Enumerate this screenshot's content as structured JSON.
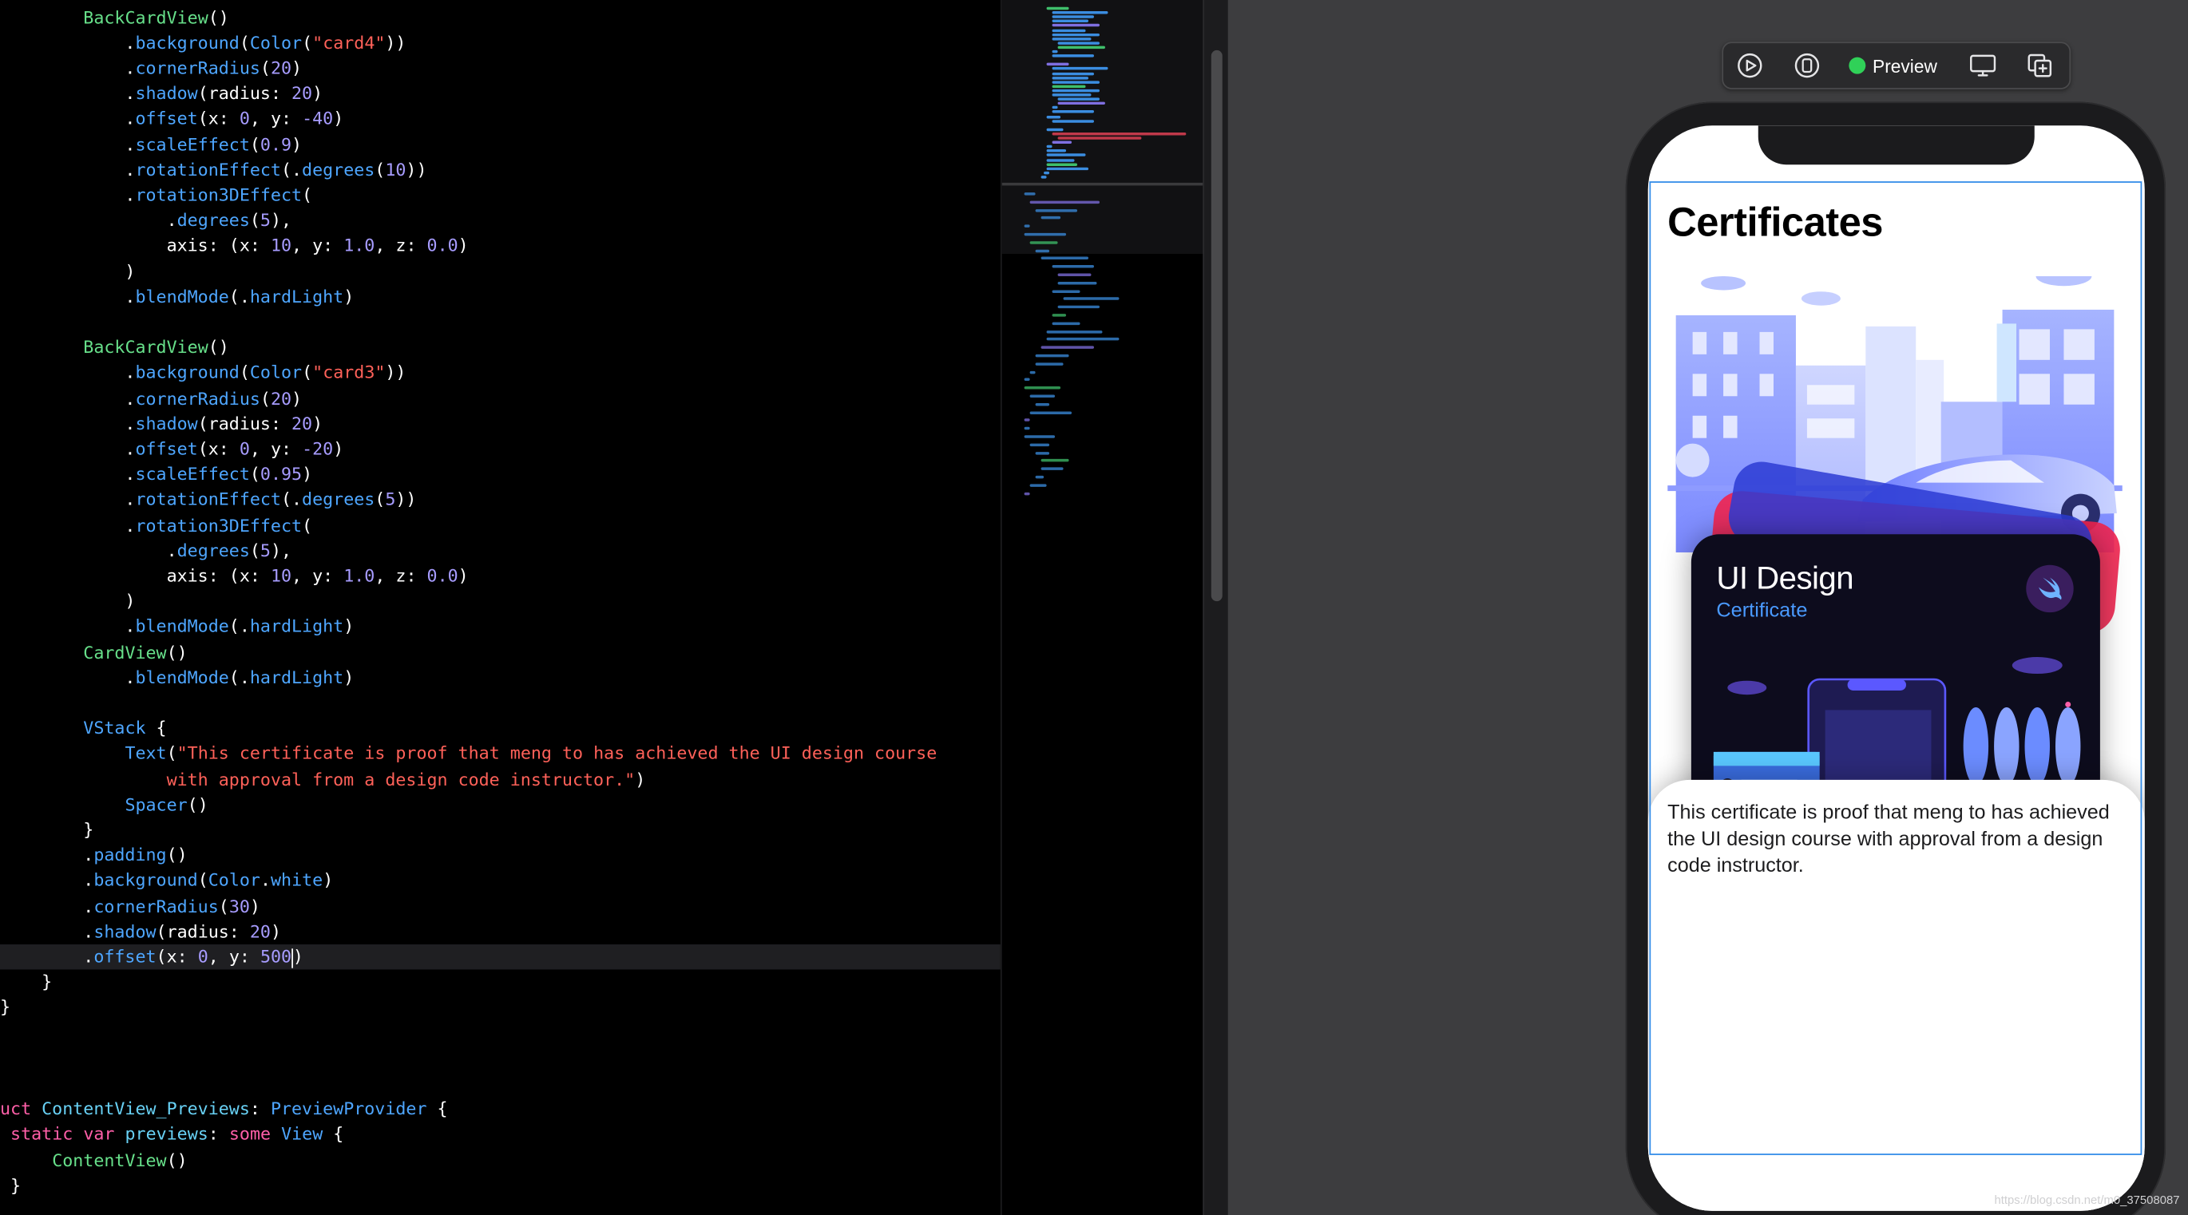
{
  "editor": {
    "lines": [
      [
        [
          "        ",
          ""
        ],
        [
          "BackCardView",
          "fn"
        ],
        [
          "()",
          ""
        ]
      ],
      [
        [
          "            .",
          ""
        ],
        [
          "background",
          "mod"
        ],
        [
          "(",
          ""
        ],
        [
          "Color",
          "type"
        ],
        [
          "(",
          ""
        ],
        [
          "\"card4\"",
          "str"
        ],
        [
          "))",
          ""
        ]
      ],
      [
        [
          "            .",
          ""
        ],
        [
          "cornerRadius",
          "mod"
        ],
        [
          "(",
          ""
        ],
        [
          "20",
          "num"
        ],
        [
          ")",
          ""
        ]
      ],
      [
        [
          "            .",
          ""
        ],
        [
          "shadow",
          "mod"
        ],
        [
          "(radius: ",
          ""
        ],
        [
          "20",
          "num"
        ],
        [
          ")",
          ""
        ]
      ],
      [
        [
          "            .",
          ""
        ],
        [
          "offset",
          "mod"
        ],
        [
          "(x: ",
          ""
        ],
        [
          "0",
          "num"
        ],
        [
          ", y: ",
          ""
        ],
        [
          "-40",
          "num"
        ],
        [
          ")",
          ""
        ]
      ],
      [
        [
          "            .",
          ""
        ],
        [
          "scaleEffect",
          "mod"
        ],
        [
          "(",
          ""
        ],
        [
          "0.9",
          "num"
        ],
        [
          ")",
          ""
        ]
      ],
      [
        [
          "            .",
          ""
        ],
        [
          "rotationEffect",
          "mod"
        ],
        [
          "(.",
          ""
        ],
        [
          "degrees",
          "mod"
        ],
        [
          "(",
          ""
        ],
        [
          "10",
          "num"
        ],
        [
          "))",
          ""
        ]
      ],
      [
        [
          "            .",
          ""
        ],
        [
          "rotation3DEffect",
          "mod"
        ],
        [
          "(",
          ""
        ]
      ],
      [
        [
          "                .",
          ""
        ],
        [
          "degrees",
          "mod"
        ],
        [
          "(",
          ""
        ],
        [
          "5",
          "num"
        ],
        [
          "),",
          ""
        ]
      ],
      [
        [
          "                axis: (x: ",
          ""
        ],
        [
          "10",
          "num"
        ],
        [
          ", y: ",
          ""
        ],
        [
          "1.0",
          "num"
        ],
        [
          ", z: ",
          ""
        ],
        [
          "0.0",
          "num"
        ],
        [
          ")",
          ""
        ]
      ],
      [
        [
          "            )",
          ""
        ]
      ],
      [
        [
          "            .",
          ""
        ],
        [
          "blendMode",
          "mod"
        ],
        [
          "(.",
          ""
        ],
        [
          "hardLight",
          "mod"
        ],
        [
          ")",
          ""
        ]
      ],
      [
        [
          "",
          ""
        ]
      ],
      [
        [
          "        ",
          ""
        ],
        [
          "BackCardView",
          "fn"
        ],
        [
          "()",
          ""
        ]
      ],
      [
        [
          "            .",
          ""
        ],
        [
          "background",
          "mod"
        ],
        [
          "(",
          ""
        ],
        [
          "Color",
          "type"
        ],
        [
          "(",
          ""
        ],
        [
          "\"card3\"",
          "str"
        ],
        [
          "))",
          ""
        ]
      ],
      [
        [
          "            .",
          ""
        ],
        [
          "cornerRadius",
          "mod"
        ],
        [
          "(",
          ""
        ],
        [
          "20",
          "num"
        ],
        [
          ")",
          ""
        ]
      ],
      [
        [
          "            .",
          ""
        ],
        [
          "shadow",
          "mod"
        ],
        [
          "(radius: ",
          ""
        ],
        [
          "20",
          "num"
        ],
        [
          ")",
          ""
        ]
      ],
      [
        [
          "            .",
          ""
        ],
        [
          "offset",
          "mod"
        ],
        [
          "(x: ",
          ""
        ],
        [
          "0",
          "num"
        ],
        [
          ", y: ",
          ""
        ],
        [
          "-20",
          "num"
        ],
        [
          ")",
          ""
        ]
      ],
      [
        [
          "            .",
          ""
        ],
        [
          "scaleEffect",
          "mod"
        ],
        [
          "(",
          ""
        ],
        [
          "0.95",
          "num"
        ],
        [
          ")",
          ""
        ]
      ],
      [
        [
          "            .",
          ""
        ],
        [
          "rotationEffect",
          "mod"
        ],
        [
          "(.",
          ""
        ],
        [
          "degrees",
          "mod"
        ],
        [
          "(",
          ""
        ],
        [
          "5",
          "num"
        ],
        [
          "))",
          ""
        ]
      ],
      [
        [
          "            .",
          ""
        ],
        [
          "rotation3DEffect",
          "mod"
        ],
        [
          "(",
          ""
        ]
      ],
      [
        [
          "                .",
          ""
        ],
        [
          "degrees",
          "mod"
        ],
        [
          "(",
          ""
        ],
        [
          "5",
          "num"
        ],
        [
          "),",
          ""
        ]
      ],
      [
        [
          "                axis: (x: ",
          ""
        ],
        [
          "10",
          "num"
        ],
        [
          ", y: ",
          ""
        ],
        [
          "1.0",
          "num"
        ],
        [
          ", z: ",
          ""
        ],
        [
          "0.0",
          "num"
        ],
        [
          ")",
          ""
        ]
      ],
      [
        [
          "            )",
          ""
        ]
      ],
      [
        [
          "            .",
          ""
        ],
        [
          "blendMode",
          "mod"
        ],
        [
          "(.",
          ""
        ],
        [
          "hardLight",
          "mod"
        ],
        [
          ")",
          ""
        ]
      ],
      [
        [
          "        ",
          ""
        ],
        [
          "CardView",
          "fn"
        ],
        [
          "()",
          ""
        ]
      ],
      [
        [
          "            .",
          ""
        ],
        [
          "blendMode",
          "mod"
        ],
        [
          "(.",
          ""
        ],
        [
          "hardLight",
          "mod"
        ],
        [
          ")",
          ""
        ]
      ],
      [
        [
          "",
          ""
        ]
      ],
      [
        [
          "        ",
          ""
        ],
        [
          "VStack",
          "type"
        ],
        [
          " {",
          ""
        ]
      ],
      [
        [
          "            ",
          ""
        ],
        [
          "Text",
          "type"
        ],
        [
          "(",
          ""
        ],
        [
          "\"This certificate is proof that meng to has achieved the UI design course",
          "str"
        ]
      ],
      [
        [
          "                ",
          ""
        ],
        [
          "with approval from a design code instructor.\"",
          "str"
        ],
        [
          ")",
          ""
        ]
      ],
      [
        [
          "            ",
          ""
        ],
        [
          "Spacer",
          "type"
        ],
        [
          "()",
          ""
        ]
      ],
      [
        [
          "        }",
          ""
        ]
      ],
      [
        [
          "        .",
          ""
        ],
        [
          "padding",
          "mod"
        ],
        [
          "()",
          ""
        ]
      ],
      [
        [
          "        .",
          ""
        ],
        [
          "background",
          "mod"
        ],
        [
          "(",
          ""
        ],
        [
          "Color",
          "type"
        ],
        [
          ".",
          ""
        ],
        [
          "white",
          "mod"
        ],
        [
          ")",
          ""
        ]
      ],
      [
        [
          "        .",
          ""
        ],
        [
          "cornerRadius",
          "mod"
        ],
        [
          "(",
          ""
        ],
        [
          "30",
          "num"
        ],
        [
          ")",
          ""
        ]
      ],
      [
        [
          "        .",
          ""
        ],
        [
          "shadow",
          "mod"
        ],
        [
          "(radius: ",
          ""
        ],
        [
          "20",
          "num"
        ],
        [
          ")",
          ""
        ]
      ],
      [
        [
          "        .",
          ""
        ],
        [
          "offset",
          "mod"
        ],
        [
          "(x: ",
          ""
        ],
        [
          "0",
          "num"
        ],
        [
          ", y: ",
          ""
        ],
        [
          "500",
          "num"
        ],
        [
          "",
          "cursor"
        ],
        [
          ")",
          ""
        ]
      ],
      [
        [
          "    }",
          ""
        ]
      ],
      [
        [
          "}",
          ""
        ]
      ],
      [
        [
          "",
          ""
        ]
      ],
      [
        [
          "",
          ""
        ]
      ],
      [
        [
          "",
          ""
        ]
      ],
      [
        [
          "uct ",
          "kw"
        ],
        [
          "ContentView_Previews",
          "cy"
        ],
        [
          ": ",
          ""
        ],
        [
          "PreviewProvider",
          "type"
        ],
        [
          " {",
          ""
        ]
      ],
      [
        [
          " ",
          ""
        ],
        [
          "static",
          "kw"
        ],
        [
          " ",
          ""
        ],
        [
          "var",
          "kw"
        ],
        [
          " ",
          ""
        ],
        [
          "previews",
          "cy"
        ],
        [
          ": ",
          ""
        ],
        [
          "some",
          "kw"
        ],
        [
          " ",
          ""
        ],
        [
          "View",
          "type"
        ],
        [
          " {",
          ""
        ]
      ],
      [
        [
          "     ",
          ""
        ],
        [
          "ContentView",
          "fn"
        ],
        [
          "()",
          ""
        ]
      ],
      [
        [
          " }",
          ""
        ]
      ]
    ],
    "active_line": 37
  },
  "toolbar": {
    "preview_label": "Preview"
  },
  "preview": {
    "title": "Certificates",
    "card": {
      "title": "UI Design",
      "subtitle": "Certificate"
    },
    "sheet_text": "This certificate is proof that meng to has achieved the UI design course with approval from a design code instructor."
  },
  "watermark": "https://blog.csdn.net/m0_37508087",
  "colors": {
    "card3": "#f1244f",
    "card4": "#2c3bd4",
    "card": "#0d0c1d",
    "accent": "#4a9aff",
    "preview_dot": "#30d158"
  }
}
